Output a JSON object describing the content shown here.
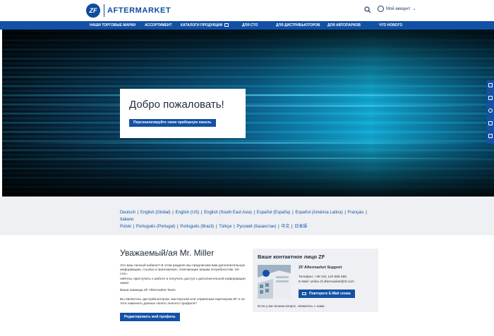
{
  "header": {
    "logo_badge": "ZF",
    "logo_text": "AFTERMARKET",
    "account_label": "Мой аккаунт"
  },
  "nav": {
    "items": [
      {
        "label": "НАШИ ТОРГОВЫЕ МАРКИ"
      },
      {
        "label": "АССОРТИМЕНТ"
      },
      {
        "label": "КАТАЛОГИ ПРОДУКЦИИ"
      },
      {
        "label": "ДЛЯ СТО"
      },
      {
        "label": "ДЛЯ ДИСТРИБЬЮТОРОВ"
      },
      {
        "label": "ДЛЯ АВТОПАРКОВ"
      },
      {
        "label": "ЧТО НОВОГО"
      }
    ]
  },
  "hero": {
    "title": "Добро пожаловать!",
    "button_label": "Персонализируйте свою приборную панель"
  },
  "languages": {
    "line1": [
      "Deutsch",
      "English (Global)",
      "English (US)",
      "English (South East Asia)",
      "Español (España)",
      "Español (América Latina)",
      "Français",
      "Italiano"
    ],
    "line2": [
      "Polski",
      "Português (Portugal)",
      "Português (Brazil)",
      "Türkçe",
      "Русский (Казахстан)",
      "中文",
      "日本語"
    ]
  },
  "greeting": {
    "title": "Уважаемый/ая Mr. Miller",
    "p1_line1": "Это ваш личный кабинет! В этом разделе мы предлагаем вам дополнительную",
    "p1_line2": "информацию, ссылки и приложения, отвечающие вашим потребностям. Не стес-",
    "p1_line3": "няйтесь приступить к работе и получить доступ к дополнительной информации",
    "p1_line4": "ниже!",
    "team": "Ваша команда ZF Aftermarket Team",
    "p2_line1": "Вы являетесь дистрибьютором, мастерской или сервисным партнером ZF и хо-",
    "p2_line2": "тите изменить данные своего личного профиля?",
    "edit_button": "Редактировать мой профиль"
  },
  "contact": {
    "title": "Ваше контактное лицо ZF",
    "name": "ZF Aftermarket Support",
    "phone": "Телефон: +49 341 140 655 665",
    "email": "E-Mail: online.zf.aftermarket@zf.com",
    "repeat_button": "Повторите E-Mail снова",
    "note": "Если у вас возник вопрос, свяжитесь с нами."
  },
  "colors": {
    "brand_blue": "#1251a6",
    "logo_blue": "#0d4c9e"
  }
}
